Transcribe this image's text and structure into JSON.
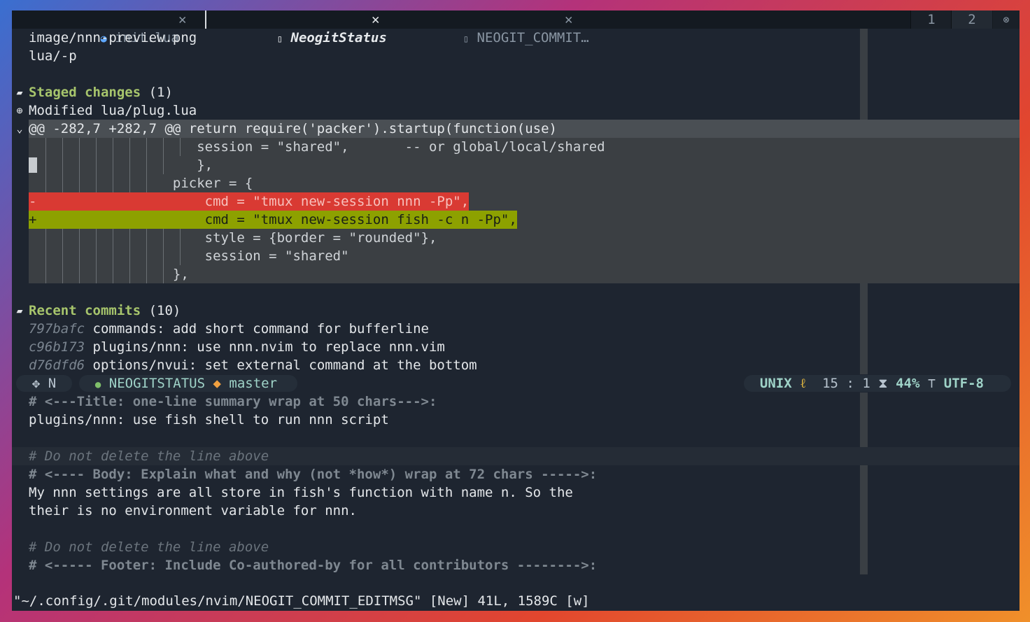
{
  "tabs": [
    {
      "icon": "lua-icon",
      "label": "init.lua",
      "close": "✕",
      "active": false
    },
    {
      "icon": "file-icon",
      "label": "NeogitStatus",
      "close": "✕",
      "active": true
    },
    {
      "icon": "file-icon",
      "label": "NEOGIT_COMMIT…",
      "close": "✕",
      "active": false
    }
  ],
  "tab_numbers": [
    "1",
    "2"
  ],
  "tab_close_all": "⊗",
  "status_buffer": {
    "untracked_tail": [
      "image/nnn-preview.png",
      "lua/-p"
    ],
    "staged": {
      "title": "Staged changes",
      "count": "(1)"
    },
    "modified_file": "Modified lua/plug.lua",
    "hunk_header": "@@ -282,7 +282,7 @@ return require('packer').startup(function(use)",
    "hunk_lines": [
      {
        "kind": "ctx",
        "text": "session = \"shared\",       -- or global/local/shared"
      },
      {
        "kind": "ctx",
        "text": "},"
      },
      {
        "kind": "ctx",
        "text": "picker = {"
      },
      {
        "kind": "del",
        "sign": "-",
        "text": "cmd = \"tmux new-session nnn -Pp\","
      },
      {
        "kind": "add",
        "sign": "+",
        "text": "cmd = \"tmux new-session fish -c n -Pp\","
      },
      {
        "kind": "ctx",
        "text": "style = {border = \"rounded\"},"
      },
      {
        "kind": "ctx",
        "text": "session = \"shared\""
      },
      {
        "kind": "ctx",
        "text": "},"
      }
    ],
    "recent": {
      "title": "Recent commits",
      "count": "(10)"
    },
    "commits": [
      {
        "hash": "797bafc",
        "msg": "commands: add short command for bufferline"
      },
      {
        "hash": "c96b173",
        "msg": "plugins/nnn: use nnn.nvim to replace nnn.vim"
      },
      {
        "hash": "d76dfd6",
        "msg": "options/nvui: set external command at the bottom"
      }
    ]
  },
  "statusline": {
    "mode": "N",
    "filetype": "NEOGITSTATUS",
    "branch": "master",
    "format": "UNIX",
    "line": "15",
    "sep": ":",
    "col": "1",
    "percent": "44%",
    "encoding": "UTF-8"
  },
  "commit_buffer": [
    {
      "style": "cmt",
      "text": "# <---Title: one-line summary wrap at 50 chars--->:"
    },
    {
      "style": "plain",
      "text": "plugins/nnn: use fish shell to run nnn script"
    },
    {
      "style": "plain",
      "text": ""
    },
    {
      "style": "cmt-i",
      "text": "# Do not delete the line above"
    },
    {
      "style": "cmt",
      "text": "# <---- Body: Explain what and why (not *how*) wrap at 72 chars ----->:"
    },
    {
      "style": "plain",
      "text": "My nnn settings are all store in fish's function with name n. So the"
    },
    {
      "style": "plain",
      "text": "their is no environment variable for nnn."
    },
    {
      "style": "plain",
      "text": ""
    },
    {
      "style": "cmt-i",
      "text": "# Do not delete the line above"
    },
    {
      "style": "cmt",
      "text": "# <----- Footer: Include Co-authored-by for all contributors -------->:"
    }
  ],
  "cmdline": "\"~/.config/.git/modules/nvim/NEOGIT_COMMIT_EDITMSG\" [New] 41L, 1589C [w]",
  "colors": {
    "bg": "#1e2530",
    "green": "#a7c56c",
    "del_bg": "#d93a33",
    "add_bg": "#8da100",
    "hunk_bg": "#3b3f43"
  }
}
